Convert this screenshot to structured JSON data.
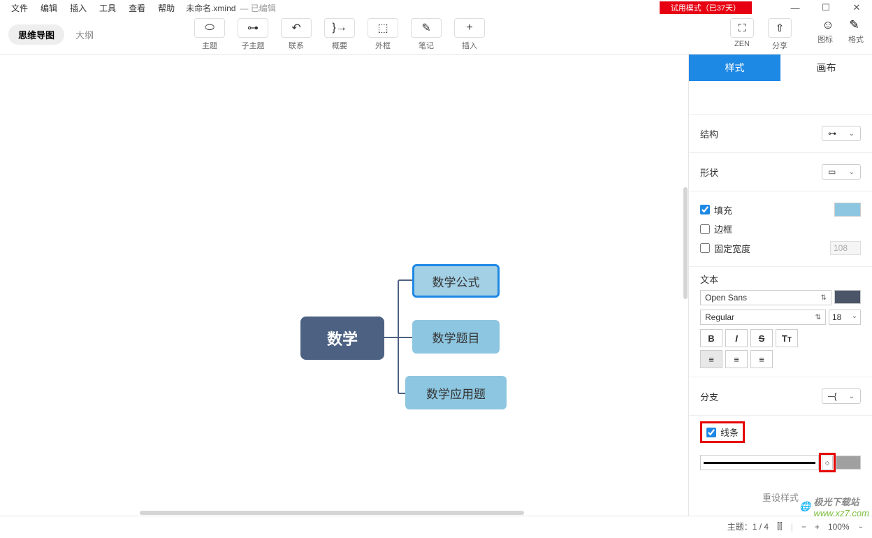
{
  "menus": [
    "文件",
    "编辑",
    "插入",
    "工具",
    "查看",
    "帮助"
  ],
  "doc_name": "未命名.xmind",
  "edited": "— 已编辑",
  "trial": "试用模式（已37天）",
  "view_mindmap": "思维导图",
  "view_outline": "大纲",
  "toolbar": [
    {
      "label": "主题",
      "icon": "⬭"
    },
    {
      "label": "子主题",
      "icon": "⊶"
    },
    {
      "label": "联系",
      "icon": "↶"
    },
    {
      "label": "概要",
      "icon": "}→"
    },
    {
      "label": "外框",
      "icon": "⬚"
    },
    {
      "label": "笔记",
      "icon": "✎"
    },
    {
      "label": "插入",
      "icon": "+"
    }
  ],
  "zen": {
    "label": "ZEN",
    "icon": "⛶"
  },
  "share": {
    "label": "分享",
    "icon": "⇧"
  },
  "righticons": {
    "emoji": "☺",
    "format": "✎",
    "emoji_lbl": "图标",
    "format_lbl": "格式"
  },
  "canvas": {
    "root": "数学",
    "subs": [
      "数学公式",
      "数学题目",
      "数学应用题"
    ]
  },
  "panel": {
    "tabs": [
      "样式",
      "画布"
    ],
    "structure": "结构",
    "shape": "形状",
    "fill": "填充",
    "border": "边框",
    "fixed_width": "固定宽度",
    "fixed_width_val": "108",
    "text": "文本",
    "font": "Open Sans",
    "weight": "Regular",
    "size": "18",
    "bold": "B",
    "italic": "I",
    "strike": "S",
    "case": "Tт",
    "branch": "分支",
    "line": "线条",
    "reset": "重设样式"
  },
  "status": {
    "topic": "主题：1 / 4",
    "zoom": "100%"
  },
  "watermark": {
    "brand": "极光下载站",
    "url": "www.xz7.com"
  }
}
